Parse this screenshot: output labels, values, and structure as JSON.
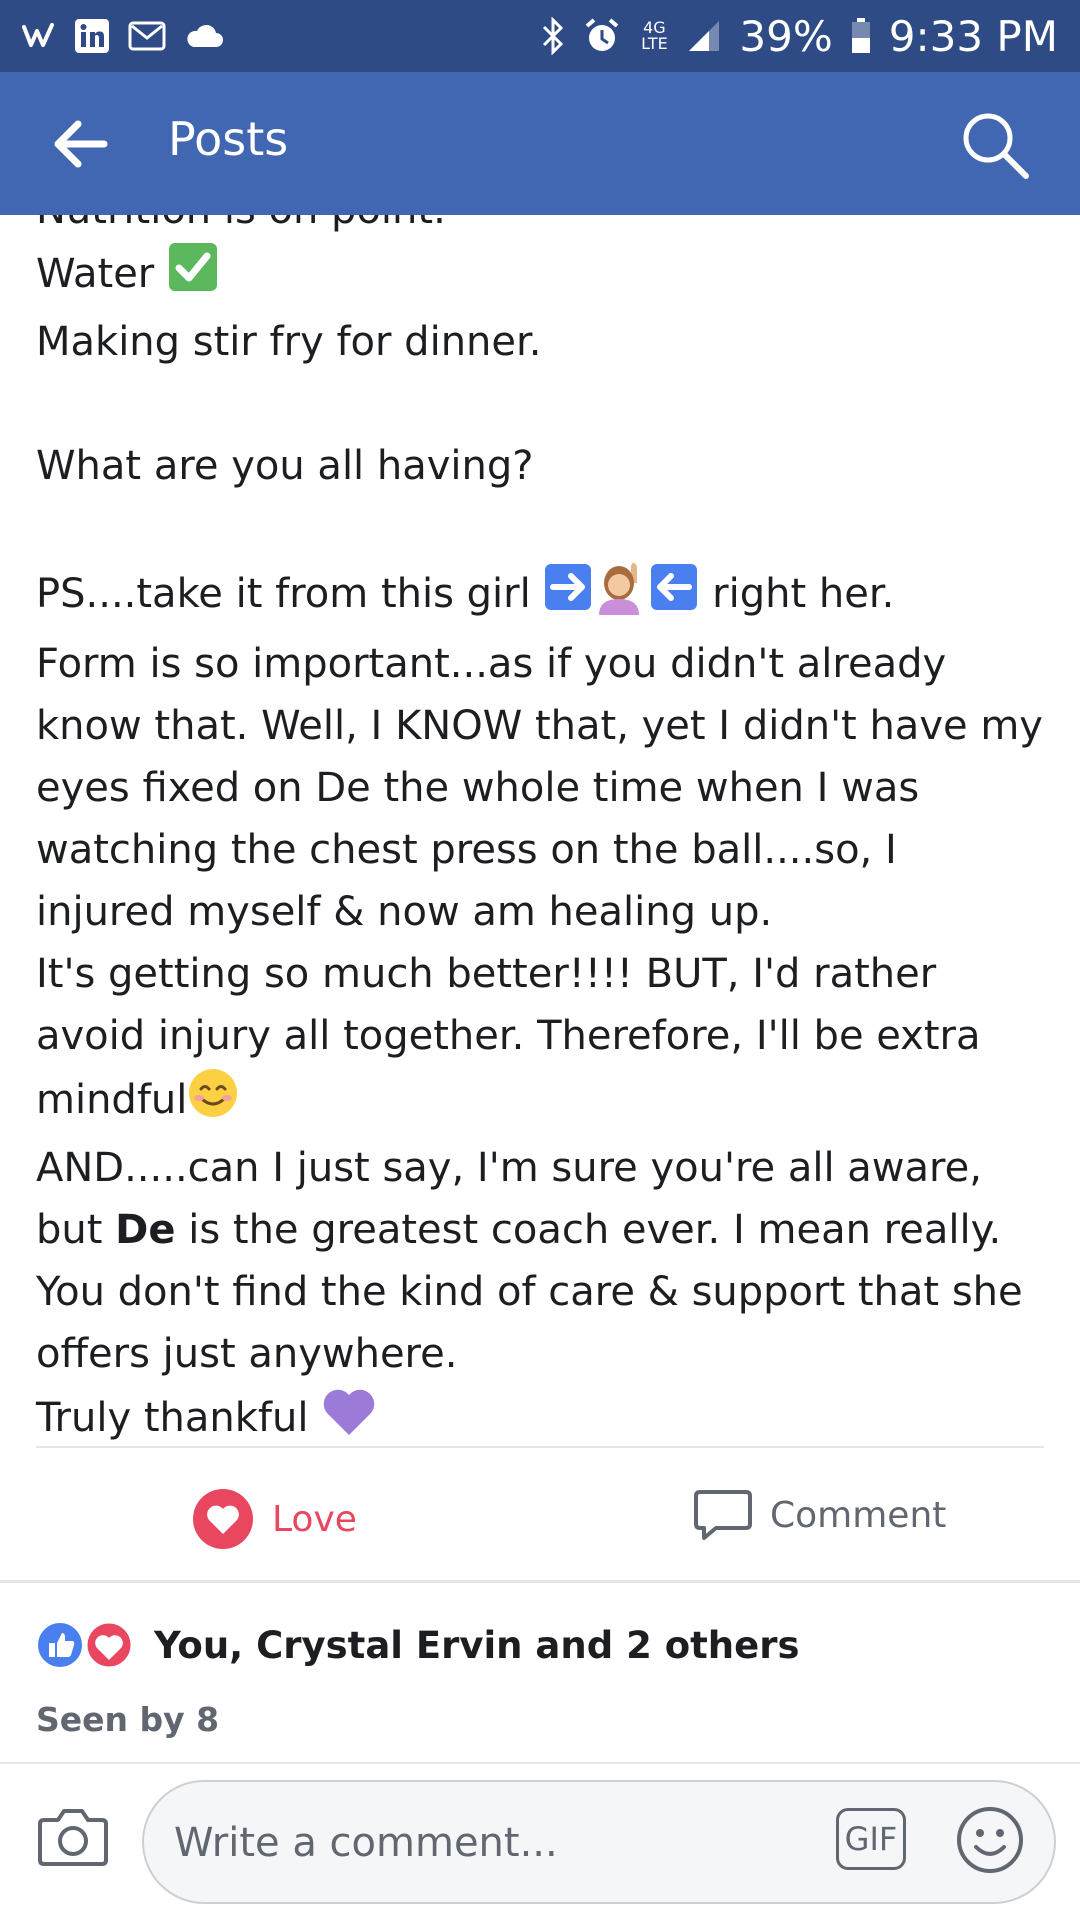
{
  "status_bar": {
    "battery": "39%",
    "time": "9:33 PM",
    "network": "4G LTE"
  },
  "app_bar": {
    "title": "Posts"
  },
  "post": {
    "line_partial": "Nutrition is on point.",
    "line_water": "Water",
    "line_dinner": "Making stir fry for dinner.",
    "line_question": "What are you all having?",
    "ps_start": "PS....take it from this girl",
    "ps_end": "right her.",
    "para_form": "Form is so important...as if you didn't already know that. Well, I KNOW that, yet I didn't have my eyes fixed on De the whole time when I was watching the chest press on the ball....so, I injured myself & now am healing up.",
    "para_better_1": "It's getting so much better!!!! BUT, I'd rather avoid injury all together. Therefore, I'll be extra mindful",
    "and_line_1": "AND.....can I just say, I'm sure you're all aware, but",
    "mention": "De",
    "and_line_2": "is the greatest coach ever. I mean really. You don't find the kind of care & support that she offers just anywhere.",
    "thankful": "Truly thankful"
  },
  "actions": {
    "love_label": "Love",
    "comment_label": "Comment"
  },
  "reactions": {
    "summary": "You, Crystal Ervin and 2 others",
    "seen": "Seen by 8"
  },
  "composer": {
    "placeholder": "Write a comment...",
    "gif_label": "GIF"
  },
  "colors": {
    "status_bar": "#2f4b86",
    "app_bar": "#4267b2",
    "love": "#e8475f",
    "like": "#4a7ff0"
  }
}
